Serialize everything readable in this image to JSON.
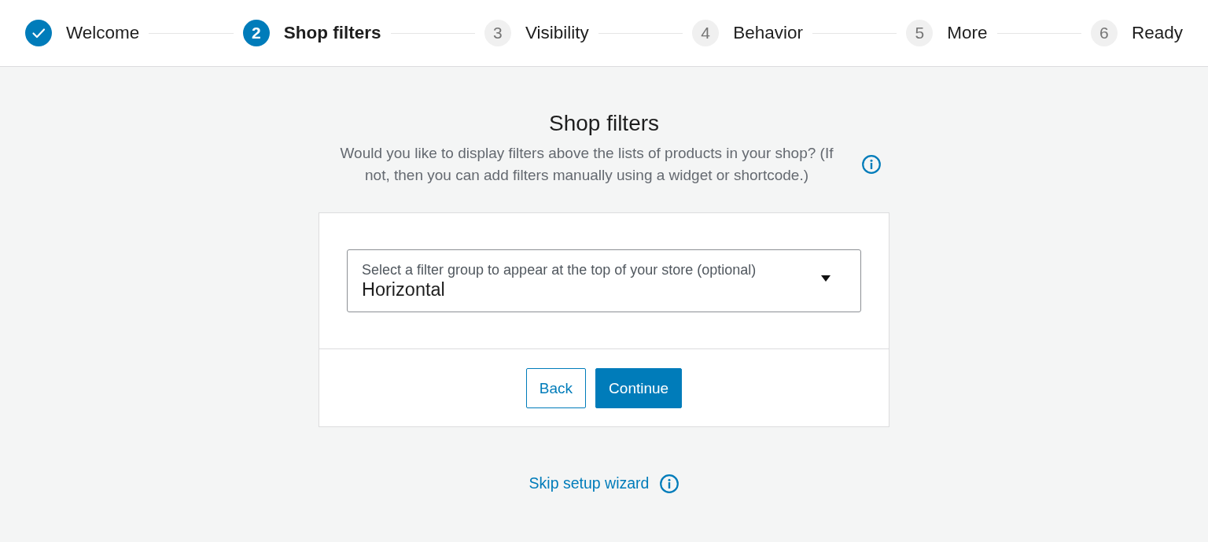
{
  "steps": [
    {
      "label": "Welcome",
      "completed": true,
      "selected": false
    },
    {
      "number": "2",
      "label": "Shop filters",
      "completed": false,
      "selected": true
    },
    {
      "number": "3",
      "label": "Visibility",
      "completed": false,
      "selected": false
    },
    {
      "number": "4",
      "label": "Behavior",
      "completed": false,
      "selected": false
    },
    {
      "number": "5",
      "label": "More",
      "completed": false,
      "selected": false
    },
    {
      "number": "6",
      "label": "Ready",
      "completed": false,
      "selected": false
    }
  ],
  "page": {
    "title": "Shop filters",
    "description": "Would you like to display filters above the lists of products in your shop? (If not, then you can add filters manually using a widget or shortcode.)"
  },
  "filter_select": {
    "label": "Select a filter group to appear at the top of your store (optional)",
    "value": "Horizontal"
  },
  "buttons": [
    {
      "label": "Back",
      "kind": "secondary"
    },
    {
      "label": "Continue",
      "kind": "primary"
    }
  ],
  "skip_link": {
    "label": "Skip setup wizard"
  }
}
